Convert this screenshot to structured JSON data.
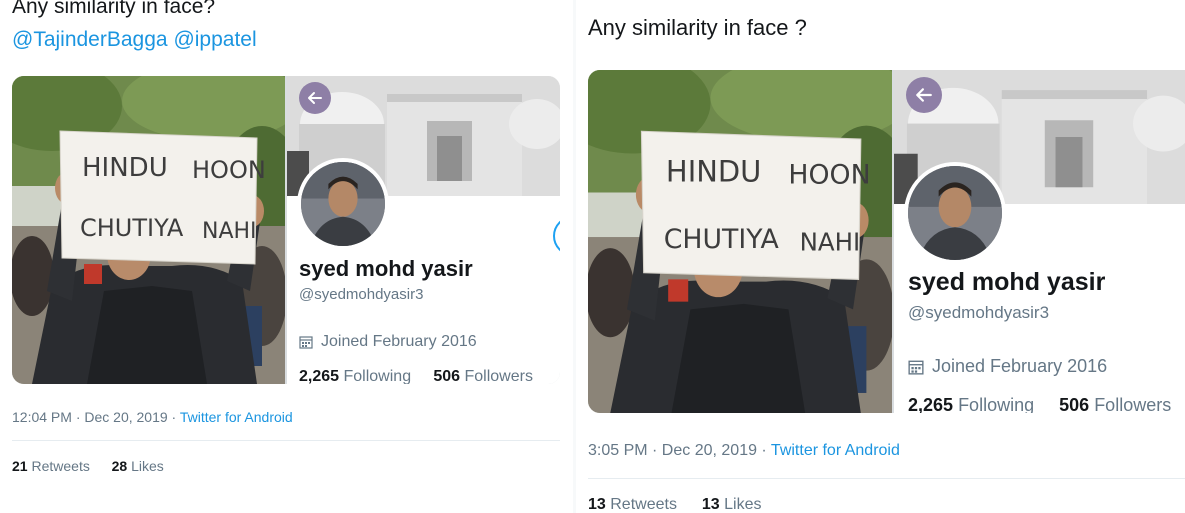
{
  "left": {
    "tweet_line1": "Any similarity in face?",
    "mention_1": "@TajinderBagga",
    "mention_2": "@ippatel",
    "sign_line1_word1": "HINDU",
    "sign_line1_word2": "HOON",
    "sign_line2_word1": "CHUTIYA",
    "sign_line2_word2": "NAHI",
    "profile_name": "syed mohd yasir",
    "profile_handle": "@syedmohdyasir3",
    "joined": "Joined February 2016",
    "following_count": "2,265",
    "following_label": "Following",
    "followers_count": "506",
    "followers_label": "Followers",
    "time_date": "12:04 PM · Dec 20, 2019 · ",
    "source": "Twitter for Android",
    "retweets_count": "21",
    "retweets_label": "Retweets",
    "likes_count": "28",
    "likes_label": "Likes"
  },
  "right": {
    "tweet_line1": "Any similarity in face ?",
    "sign_line1_word1": "HINDU",
    "sign_line1_word2": "HOON",
    "sign_line2_word1": "CHUTIYA",
    "sign_line2_word2": "NAHI",
    "profile_name": "syed mohd yasir",
    "profile_handle": "@syedmohdyasir3",
    "joined": "Joined February 2016",
    "following_count": "2,265",
    "following_label": "Following",
    "followers_count": "506",
    "followers_label": "Followers",
    "time_date": "3:05 PM · Dec 20, 2019 · ",
    "source": "Twitter for Android",
    "retweets_count": "13",
    "retweets_label": "Retweets",
    "likes_count": "13",
    "likes_label": "Likes"
  },
  "colors": {
    "link": "#1b95e0",
    "text": "#14171a",
    "muted": "#657786",
    "back_button": "#8e7fa6"
  },
  "icons": [
    "back-arrow-icon",
    "calendar-icon"
  ]
}
